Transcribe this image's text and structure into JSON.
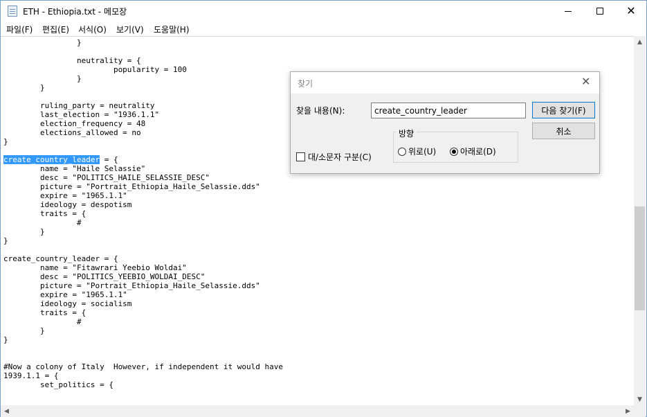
{
  "window": {
    "title": "ETH - Ethiopia.txt - 메모장",
    "app_icon": "notepad-icon",
    "controls": {
      "minimize_icon": "minimize-icon",
      "maximize_icon": "maximize-icon",
      "close_icon": "close-icon",
      "close_glyph": "✕"
    }
  },
  "menu": {
    "items": [
      "파일(F)",
      "편집(E)",
      "서식(O)",
      "보기(V)",
      "도움말(H)"
    ]
  },
  "editor": {
    "highlighted_text": "create_country_leader",
    "lines": [
      "                }",
      "",
      "                neutrality = {",
      "                        popularity = 100",
      "                }",
      "        }",
      "",
      "        ruling_party = neutrality",
      "        last_election = \"1936.1.1\"",
      "        election_frequency = 48",
      "        elections_allowed = no",
      "}",
      "",
      " = {",
      "        name = \"Haile Selassie\"",
      "        desc = \"POLITICS_HAILE_SELASSIE_DESC\"",
      "        picture = \"Portrait_Ethiopia_Haile_Selassie.dds\"",
      "        expire = \"1965.1.1\"",
      "        ideology = despotism",
      "        traits = {",
      "                #",
      "        }",
      "}",
      "",
      "create_country_leader = {",
      "        name = \"Fitawrari Yeebio Woldai\"",
      "        desc = \"POLITICS_YEEBIO_WOLDAI_DESC\"",
      "        picture = \"Portrait_Ethiopia_Haile_Selassie.dds\"",
      "        expire = \"1965.1.1\"",
      "        ideology = socialism",
      "        traits = {",
      "                #",
      "        }",
      "}",
      "",
      "",
      "#Now a colony of Italy  However, if independent it would have",
      "1939.1.1 = {",
      "        set_politics = {"
    ]
  },
  "scrollbars": {
    "up_glyph": "▲",
    "down_glyph": "▼",
    "left_glyph": "◀",
    "right_glyph": "▶"
  },
  "find_dialog": {
    "title": "찾기",
    "close_glyph": "✕",
    "find_label": "찾을 내용(N):",
    "find_value": "create_country_leader",
    "find_next_label": "다음 찾기(F)",
    "cancel_label": "취소",
    "match_case_label": "대/소문자 구분(C)",
    "match_case_checked": false,
    "direction_label": "방향",
    "direction_up_label": "위로(U)",
    "direction_down_label": "아래로(D)",
    "direction_selected": "down"
  }
}
